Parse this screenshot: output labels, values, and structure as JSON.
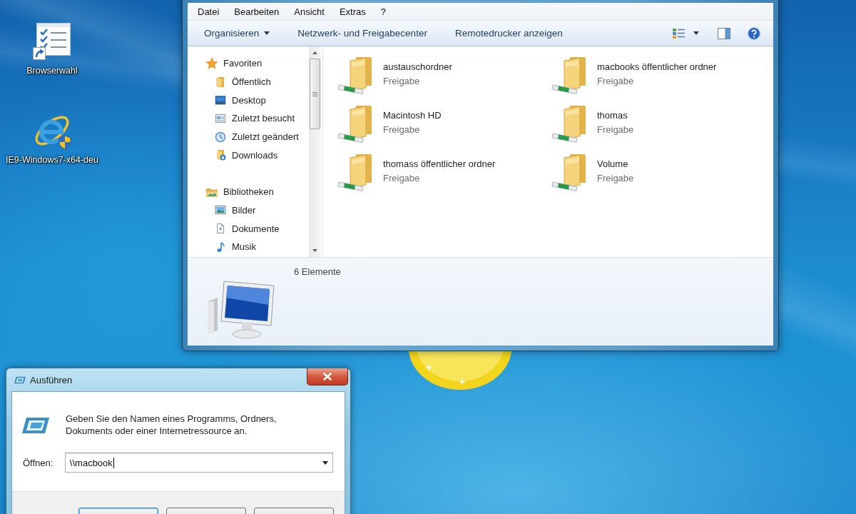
{
  "desktop": {
    "icons": [
      {
        "label": "Browserwahl",
        "kind": "checklist",
        "shortcut": true
      },
      {
        "label": "IE9-Windows7-x64-deu",
        "kind": "browser",
        "shortcut": false
      }
    ]
  },
  "explorer": {
    "menu": [
      "Datei",
      "Bearbeiten",
      "Ansicht",
      "Extras",
      "?"
    ],
    "toolbar": [
      {
        "label": "Organisieren",
        "dropdown": true
      },
      {
        "label": "Netzwerk- und Freigabecenter",
        "dropdown": false
      },
      {
        "label": "Remotedrucker anzeigen",
        "dropdown": false
      }
    ],
    "navigation": [
      {
        "label": "Favoriten",
        "kind": "favorites",
        "children": [
          {
            "label": "Öffentlich",
            "kind": "folder"
          },
          {
            "label": "Desktop",
            "kind": "screen"
          },
          {
            "label": "Zuletzt besucht",
            "kind": "places"
          },
          {
            "label": "Zuletzt geändert",
            "kind": "clock"
          },
          {
            "label": "Downloads",
            "kind": "downloads"
          }
        ]
      },
      {
        "label": "Bibliotheken",
        "kind": "libraries",
        "children": [
          {
            "label": "Bilder",
            "kind": "pictures"
          },
          {
            "label": "Dokumente",
            "kind": "documents"
          },
          {
            "label": "Musik",
            "kind": "music"
          }
        ]
      }
    ],
    "items": [
      {
        "name": "austauschordner",
        "type": "Freigabe"
      },
      {
        "name": "macbooks öffentlicher ordner",
        "type": "Freigabe"
      },
      {
        "name": "Macintosh HD",
        "type": "Freigabe"
      },
      {
        "name": "thomas",
        "type": "Freigabe"
      },
      {
        "name": "thomass öffentlicher ordner",
        "type": "Freigabe"
      },
      {
        "name": "Volume",
        "type": "Freigabe"
      }
    ],
    "details": {
      "count": "6 Elemente"
    }
  },
  "run_dialog": {
    "title": "Ausführen",
    "message": "Geben Sie den Namen eines Programms, Ordners, Dokuments oder einer Internetressource an.",
    "open_label": "Öffnen:",
    "value": "\\\\macbook",
    "buttons": [
      {
        "default": true
      },
      {
        "default": false
      },
      {
        "default": false
      }
    ]
  }
}
